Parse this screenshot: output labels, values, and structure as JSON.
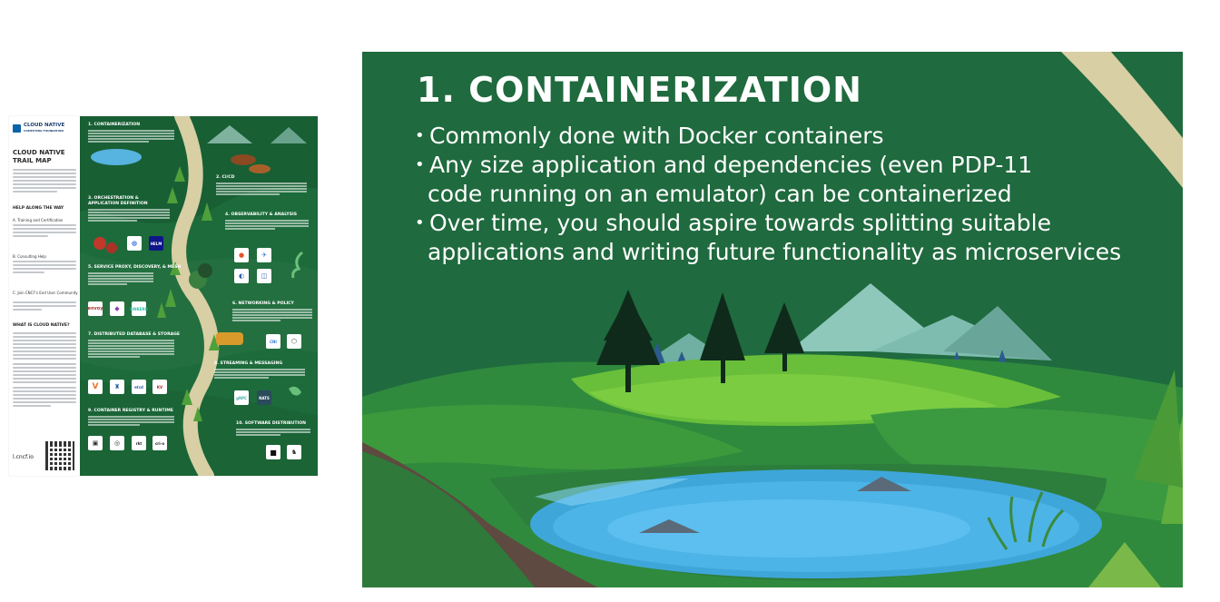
{
  "trail_map": {
    "org_name": "CLOUD NATIVE",
    "org_sub": "COMPUTING FOUNDATION",
    "title": "CLOUD NATIVE TRAIL MAP",
    "help_heading": "HELP ALONG THE WAY",
    "help_a": "A. Training and Certification",
    "help_b": "B. Consulting Help",
    "help_c": "C. Join CNCF's End User Community",
    "what_is": "WHAT IS CLOUD NATIVE?",
    "link": "l.cncf.io",
    "sections": [
      "1. CONTAINERIZATION",
      "2. CI/CD",
      "3. ORCHESTRATION & APPLICATION DEFINITION",
      "4. OBSERVABILITY & ANALYSIS",
      "5. SERVICE PROXY, DISCOVERY, & MESH",
      "6. NETWORKING & POLICY",
      "7. DISTRIBUTED DATABASE & STORAGE",
      "8. STREAMING & MESSAGING",
      "9. CONTAINER REGISTRY & RUNTIME",
      "10. SOFTWARE DISTRIBUTION"
    ],
    "tiles": [
      "HELM",
      "CNI",
      "gRPC",
      "KV",
      "cri-o",
      "rkt",
      "etcd"
    ]
  },
  "slide": {
    "title": "1. CONTAINERIZATION",
    "bullets": [
      {
        "line1": "Commonly done with Docker containers",
        "line2": ""
      },
      {
        "line1": "Any size application and dependencies (even PDP-11",
        "line2": "code running on an emulator) can be containerized"
      },
      {
        "line1": "Over time, you should aspire towards splitting suitable",
        "line2": "applications and writing future functionality as microservices"
      }
    ]
  },
  "colors": {
    "forest": "#1f6a3e",
    "lake": "#3fa6da",
    "grass": "#5cae3c",
    "path": "#d8cfa4"
  }
}
